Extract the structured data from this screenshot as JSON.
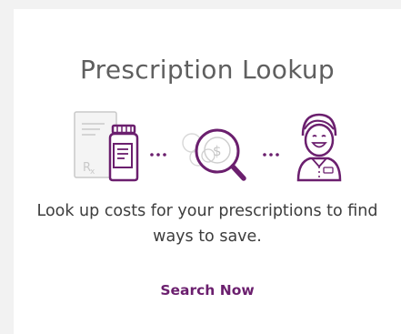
{
  "card": {
    "title": "Prescription Lookup",
    "description": "Look up costs for your prescriptions to find ways to save.",
    "action_label": "Search Now"
  },
  "illustration": {
    "icons": [
      "prescription-pad-icon",
      "pill-bottle-icon",
      "magnifying-glass-dollar-icon",
      "pharmacist-icon"
    ],
    "separator": "...",
    "colors": {
      "accent": "#6b1f6e",
      "light_gray": "#c9c9c9",
      "light_fill": "#f4f4f4"
    }
  }
}
